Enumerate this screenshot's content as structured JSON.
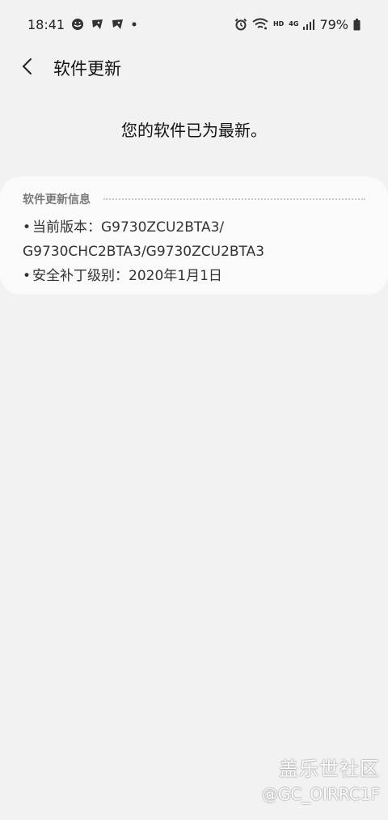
{
  "status_bar": {
    "time": "18:41",
    "network_hd": "HD",
    "network_4g": "4G",
    "battery_percent": "79%",
    "icons": [
      "notification-app-icon",
      "notification-app-icon",
      "notification-app-icon",
      "dot-icon",
      "alarm-icon",
      "wifi-icon",
      "signal-icon",
      "battery-icon"
    ]
  },
  "header": {
    "title": "软件更新"
  },
  "status_message": "您的软件已为最新。",
  "info_section": {
    "title": "软件更新信息",
    "items": [
      {
        "label": "当前版本：",
        "value_line1": "G9730ZCU2BTA3/",
        "value_line2": "G9730CHC2BTA3/G9730ZCU2BTA3"
      },
      {
        "label": "安全补丁级别：",
        "value": "2020年1月1日"
      }
    ]
  },
  "watermark": {
    "brand": "盖乐世社区",
    "user": "@GC_OIRRC1F"
  }
}
